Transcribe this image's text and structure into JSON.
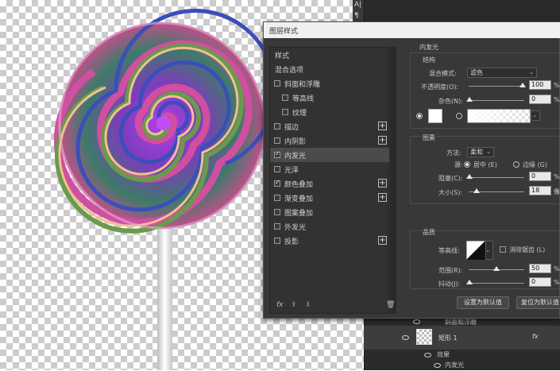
{
  "dialog": {
    "title": "图层样式",
    "styles_header": "样式",
    "blend_options": "混合选项",
    "items": [
      {
        "label": "斜面和浮雕",
        "checked": false,
        "plus": false,
        "indent": false
      },
      {
        "label": "等高线",
        "checked": false,
        "plus": false,
        "indent": true
      },
      {
        "label": "纹理",
        "checked": false,
        "plus": false,
        "indent": true
      },
      {
        "label": "描边",
        "checked": false,
        "plus": true,
        "indent": false
      },
      {
        "label": "内阴影",
        "checked": false,
        "plus": true,
        "indent": false
      },
      {
        "label": "内发光",
        "checked": true,
        "plus": false,
        "indent": false,
        "active": true
      },
      {
        "label": "光泽",
        "checked": false,
        "plus": false,
        "indent": false
      },
      {
        "label": "颜色叠加",
        "checked": true,
        "plus": true,
        "indent": false
      },
      {
        "label": "渐变叠加",
        "checked": false,
        "plus": true,
        "indent": false
      },
      {
        "label": "图案叠加",
        "checked": false,
        "plus": false,
        "indent": false
      },
      {
        "label": "外发光",
        "checked": false,
        "plus": false,
        "indent": false
      },
      {
        "label": "投影",
        "checked": false,
        "plus": true,
        "indent": false
      }
    ],
    "fx_label": "fx",
    "plus_glyph": "+",
    "up_glyph": "⬆",
    "down_glyph": "⬇",
    "trash_glyph": "🗑",
    "checkmark": "✓",
    "color_stop_glyph": "⦿"
  },
  "inner_glow": {
    "section_title": "内发光",
    "structure_title": "结构",
    "blend_mode_label": "混合模式:",
    "blend_mode_value": "滤色",
    "opacity_label": "不透明度(O):",
    "opacity_value": "100",
    "noise_label": "杂色(N):",
    "noise_value": "0",
    "percent": "%",
    "elements_title": "图素",
    "method_label": "方法:",
    "method_value": "柔和",
    "source_label": "源:",
    "source_center": "居中 (E)",
    "source_edge": "边缘 (G)",
    "choke_label": "阻塞(C):",
    "choke_value": "0",
    "size_label": "大小(S):",
    "size_value": "18",
    "size_unit": "像",
    "quality_title": "品质",
    "contour_label": "等高线:",
    "antialias_label": "消除锯齿 (L)",
    "range_label": "范围(R):",
    "range_value": "50",
    "jitter_label": "抖动(J):",
    "jitter_value": "0",
    "set_default": "设置为默认值",
    "reset_default": "复位为默认值",
    "dropdown_glyph": "⌄",
    "glow_color": "#ffffff"
  },
  "layers": {
    "layer_name": "矩形 1",
    "effects_label": "效果",
    "effect_inner_glow": "内发光",
    "partial_row": "斜面和浮雕",
    "fx": "fx",
    "tool_a": "A|",
    "tool_b": "¶"
  }
}
